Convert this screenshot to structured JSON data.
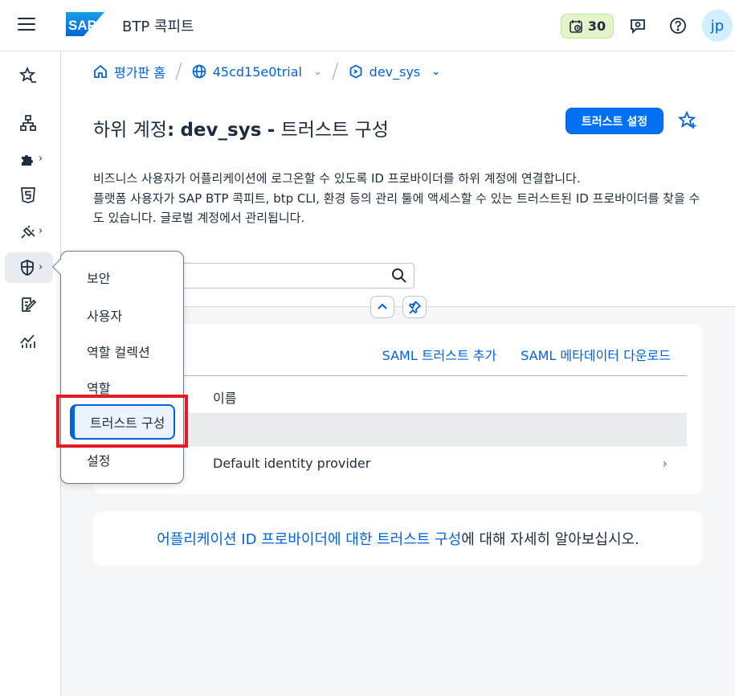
{
  "shell": {
    "product_name": "BTP 콕피트",
    "trial_days": "30",
    "avatar_initials": "jp",
    "colors": {
      "accent": "#0070f2",
      "brand": "#0064d9",
      "trial_badge": "#e5f4c8"
    }
  },
  "breadcrumb": {
    "home": "평가판 홈",
    "global_account": "45cd15e0trial",
    "subaccount": "dev_sys"
  },
  "page": {
    "title_prefix": "하위 계정",
    "title_colon": ":",
    "title_name": "dev_sys",
    "title_dash": "-",
    "title_suffix": "트러스트 구성",
    "trust_setup_button": "트러스트 설정",
    "description_line1": "비즈니스 사용자가 어플리케이션에 로그온할 수 있도록 ID 프로바이더를 하위 계정에 연결합니다.",
    "description_line2": "플랫폼 사용자가 SAP BTP 콕피트, btp CLI, 환경 등의 관리 툴에 액세스할 수 있는 트러스트된 ID 프로바이더를 찾을 수도 있습니다. 글로벌 계정에서 관리됩니다."
  },
  "table": {
    "action_add_saml": "SAML 트러스트 추가",
    "action_download_metadata": "SAML 메타데이터 다운로드",
    "column_name": "이름",
    "rows": [
      "Default identity provider"
    ]
  },
  "info": {
    "link_text": "어플리케이션 ID 프로바이더에 대한 트러스트 구성",
    "suffix_text": "에 대해 자세히 알아보십시오."
  },
  "popover_menu": {
    "items": [
      "보안",
      "사용자",
      "역할 컬렉션",
      "역할",
      "트러스트 구성",
      "설정"
    ],
    "selected": "트러스트 구성"
  }
}
